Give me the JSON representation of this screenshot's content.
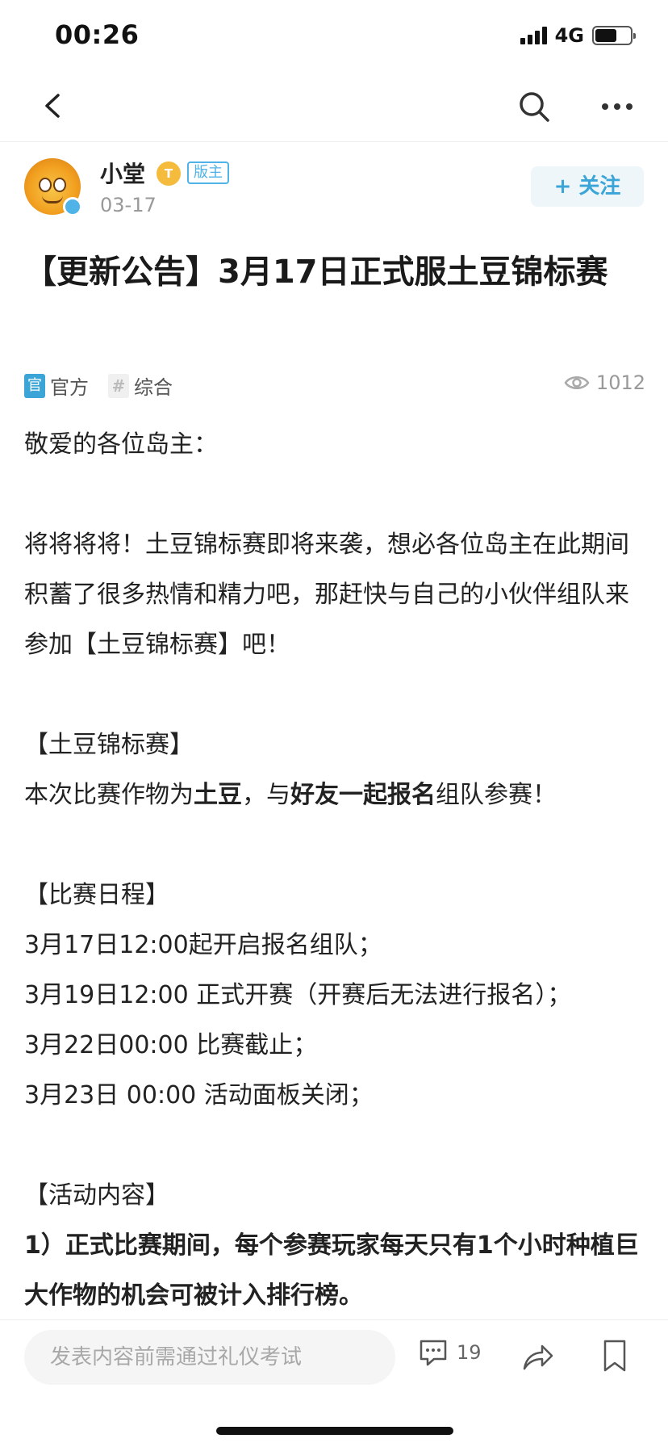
{
  "status_bar": {
    "time": "00:26",
    "network": "4G",
    "battery_level": 0.62
  },
  "nav": {
    "back_icon": "chevron-left-icon",
    "search_icon": "search-icon",
    "more_icon": "more-horizontal-icon"
  },
  "author": {
    "name": "小堂",
    "level_badge": "T",
    "role_badge": "版主",
    "date": "03-17",
    "follow_label": "+ 关注"
  },
  "post": {
    "title": "【更新公告】3月17日正式服土豆锦标赛",
    "tags": {
      "official": "官方",
      "official_icon_text": "官",
      "topic": "综合",
      "topic_icon_text": "#"
    },
    "views": "1012",
    "content": {
      "greeting": "敬爱的各位岛主：",
      "intro": "将将将将！土豆锦标赛即将来袭，想必各位岛主在此期间积蓄了很多热情和精力吧，那赶快与自己的小伙伴组队来参加【土豆锦标赛】吧！",
      "section1_title": "【土豆锦标赛】",
      "section1_pre": "本次比赛作物为",
      "section1_crop": "土豆",
      "section1_mid": "，与",
      "section1_highlight": "好友一起报名",
      "section1_post": "组队参赛！",
      "section2_title": "【比赛日程】",
      "schedule": [
        "3月17日12:00起开启报名组队；",
        "3月19日12:00 正式开赛（开赛后无法进行报名）；",
        "3月22日00:00 比赛截止；",
        "3月23日 00:00 活动面板关闭；"
      ],
      "section3_title": "【活动内容】",
      "rule1": "1）正式比赛期间，每个参赛玩家每天只有1个小时种植巨大作物的机会可被计入排行榜。"
    }
  },
  "bottom_bar": {
    "input_placeholder": "发表内容前需通过礼仪考试",
    "comment_count": "19"
  }
}
